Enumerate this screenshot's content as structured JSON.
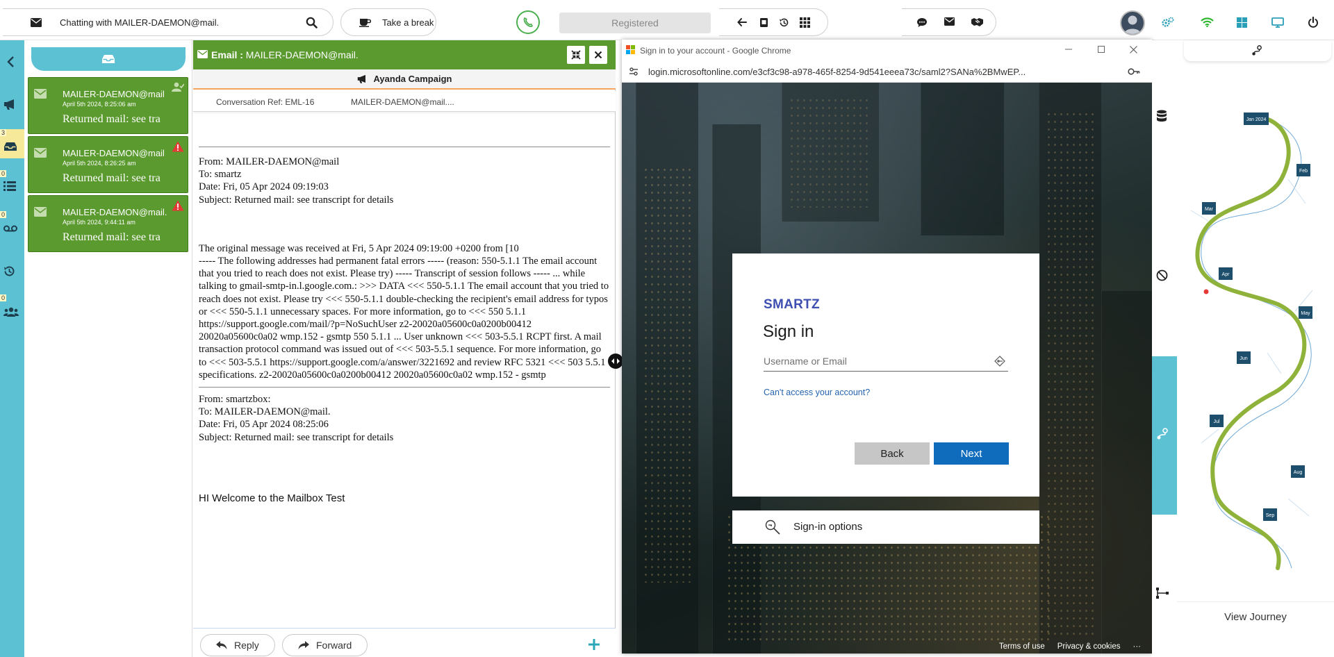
{
  "topbar": {
    "chatting_with": "Chatting with MAILER-DAEMON@mail.",
    "take_break": "Take a break",
    "registered": "Registered"
  },
  "rail": {
    "badges": [
      "3",
      "0",
      "0",
      "0"
    ]
  },
  "conversations": [
    {
      "from": "MAILER-DAEMON@mail",
      "date": "April 5th 2024, 8:25:06 am",
      "subject": "Returned mail: see tra"
    },
    {
      "from": "MAILER-DAEMON@mail",
      "date": "April 5th 2024, 8:26:25 am",
      "subject": "Returned mail: see tra"
    },
    {
      "from": "MAILER-DAEMON@mail.",
      "date": "April 5th 2024, 9:44:11 am",
      "subject": "Returned mail: see tra"
    }
  ],
  "email": {
    "header_label": "Email :",
    "header_address": "MAILER-DAEMON@mail.",
    "campaign": "Ayanda Campaign",
    "conversation_ref": "Conversation Ref: EML-16",
    "ref_address": "MAILER-DAEMON@mail....",
    "msg1_headers": "From: MAILER-DAEMON@mail\nTo: smartz\nDate: Fri, 05 Apr 2024 09:19:03\nSubject: Returned mail: see transcript for details",
    "msg1_body": "The original message was received at Fri, 5 Apr 2024 09:19:00 +0200 from [10\n----- The following addresses had permanent fatal errors ----- (reason: 550-5.1.1 The email account that you tried to reach does not exist. Please try) ----- Transcript of session follows ----- ... while talking to gmail-smtp-in.l.google.com.: >>> DATA <<< 550-5.1.1 The email account that you tried to reach does not exist. Please try <<< 550-5.1.1 double-checking the recipient's email address for typos or <<< 550-5.1.1 unnecessary spaces. For more information, go to <<< 550 5.1.1 https://support.google.com/mail/?p=NoSuchUser z2-20020a05600c0a0200b00412 20020a05600c0a02 wmp.152 - gsmtp 550 5.1.1 ... User unknown <<< 503-5.5.1 RCPT first. A mail transaction protocol command was issued out of <<< 503-5.5.1 sequence. For more information, go to <<< 503-5.5.1 https://support.google.com/a/answer/3221692 and review RFC 5321 <<< 503 5.5.1 specifications. z2-20020a05600c0a0200b00412 20020a05600c0a02 wmp.152 - gsmtp",
    "msg2_headers": "From: smartzbox:\nTo: MAILER-DAEMON@mail.\nDate: Fri, 05 Apr 2024 08:25:06\nSubject: Returned mail: see transcript for details",
    "msg2_body": "HI Welcome to the Mailbox Test",
    "reply": "Reply",
    "forward": "Forward"
  },
  "browser": {
    "tab_title": "Sign in to your account - Google Chrome",
    "url": "login.microsoftonline.com/e3cf3c98-a978-465f-8254-9d541eeea73c/saml2?SAMLRequest=...",
    "url_display": "login.microsoftonline.com/e3cf3c98-a978-465f-8254-9d541eeea73c/saml2?SANa%2BMwEP...",
    "brand": "SMARTZ",
    "heading": "Sign in",
    "username_placeholder": "Username or Email",
    "cant_access": "Can't access your account?",
    "back": "Back",
    "next": "Next",
    "sign_in_options": "Sign-in options",
    "terms": "Terms of use",
    "privacy": "Privacy & cookies",
    "more": "···"
  },
  "journey": {
    "months": [
      "Jan 2024",
      "Feb",
      "Mar",
      "Apr",
      "May",
      "Jun",
      "Jul",
      "Aug",
      "Sep"
    ],
    "view_journey": "View Journey"
  },
  "colors": {
    "teal": "#5bc1d3",
    "green": "#5b9a2f",
    "journey_green": "#8fb23a",
    "journey_node": "#1d4f6d",
    "next_blue": "#0f6cbd",
    "brand_blue": "#3e4fb1"
  }
}
